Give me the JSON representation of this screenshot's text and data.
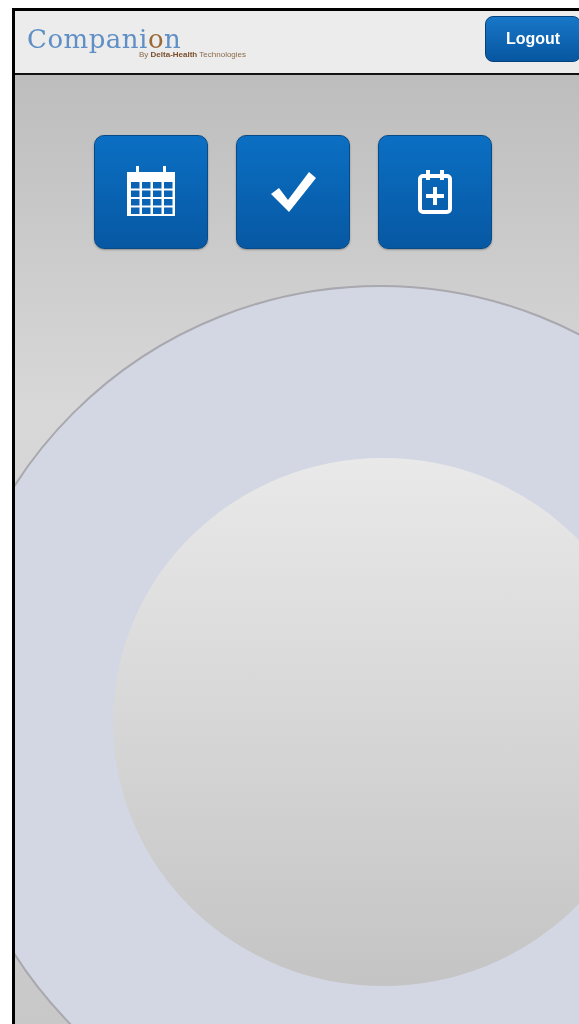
{
  "header": {
    "logo": [
      {
        "text": "Compani",
        "accent": false
      },
      {
        "text": "o",
        "accent": true
      },
      {
        "text": "n",
        "accent": false
      }
    ],
    "tagline": "By **Delta-Health** Technologies",
    "logout": "Logout"
  },
  "actions": [
    {
      "kind": "calendar"
    },
    {
      "kind": "check"
    },
    {
      "kind": "add-event"
    }
  ]
}
